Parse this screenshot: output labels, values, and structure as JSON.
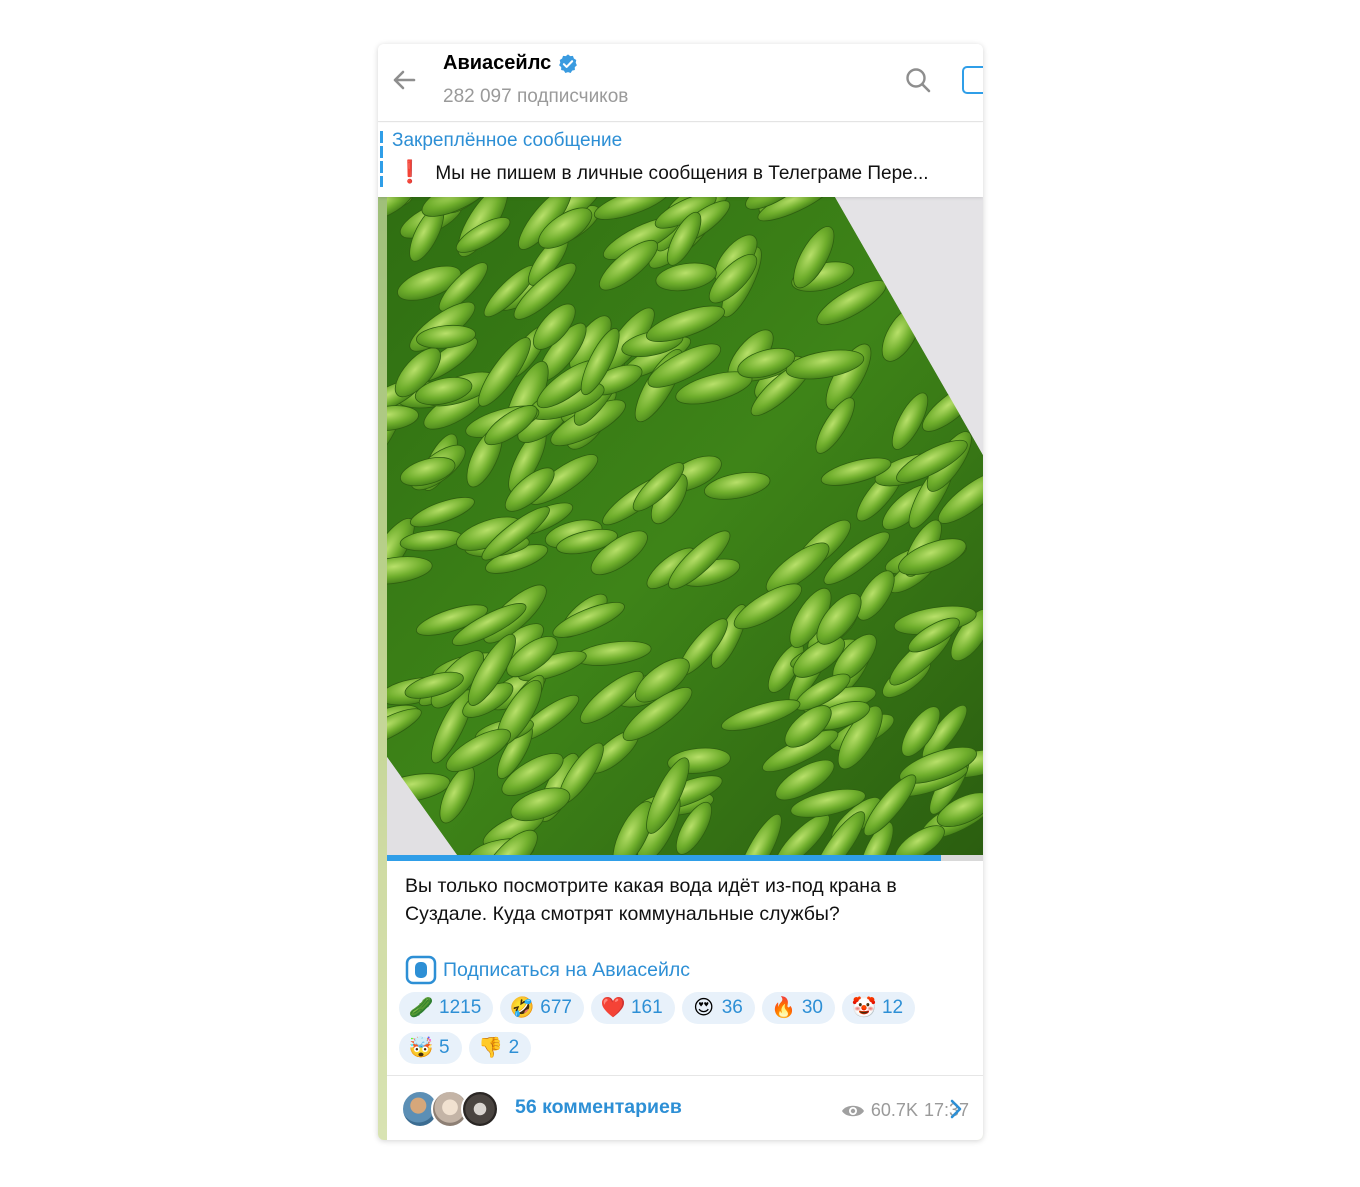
{
  "header": {
    "title": "Авиасейлс",
    "subtitle": "282 097 подписчиков"
  },
  "pinned": {
    "title": "Закреплённое сообщение",
    "icon": "❗",
    "text": "Мы не пишем в личные сообщения в Телеграме  Пере..."
  },
  "message": {
    "video_progress": 0.93,
    "caption": "Вы только посмотрите какая вода идёт из-под крана в Суздале. Куда смотрят коммунальные службы?",
    "subscribe_label": "Подписаться на Авиасейлс",
    "reactions": [
      {
        "emoji": "🥒",
        "count": "1215"
      },
      {
        "emoji": "🤣",
        "count": "677"
      },
      {
        "emoji": "❤️",
        "count": "161"
      },
      {
        "emoji": "😍",
        "count": "36"
      },
      {
        "emoji": "🔥",
        "count": "30"
      },
      {
        "emoji": "🤡",
        "count": "12"
      },
      {
        "emoji": "🤯",
        "count": "5"
      },
      {
        "emoji": "👎",
        "count": "2"
      }
    ],
    "views": "60.7K",
    "time": "17:37",
    "comments_label": "56 комментариев"
  },
  "colors": {
    "accent": "#2d8fd5",
    "progress": "#2f9ee8",
    "reaction_bg": "#e8f1fa",
    "muted": "#9a9a9a"
  }
}
